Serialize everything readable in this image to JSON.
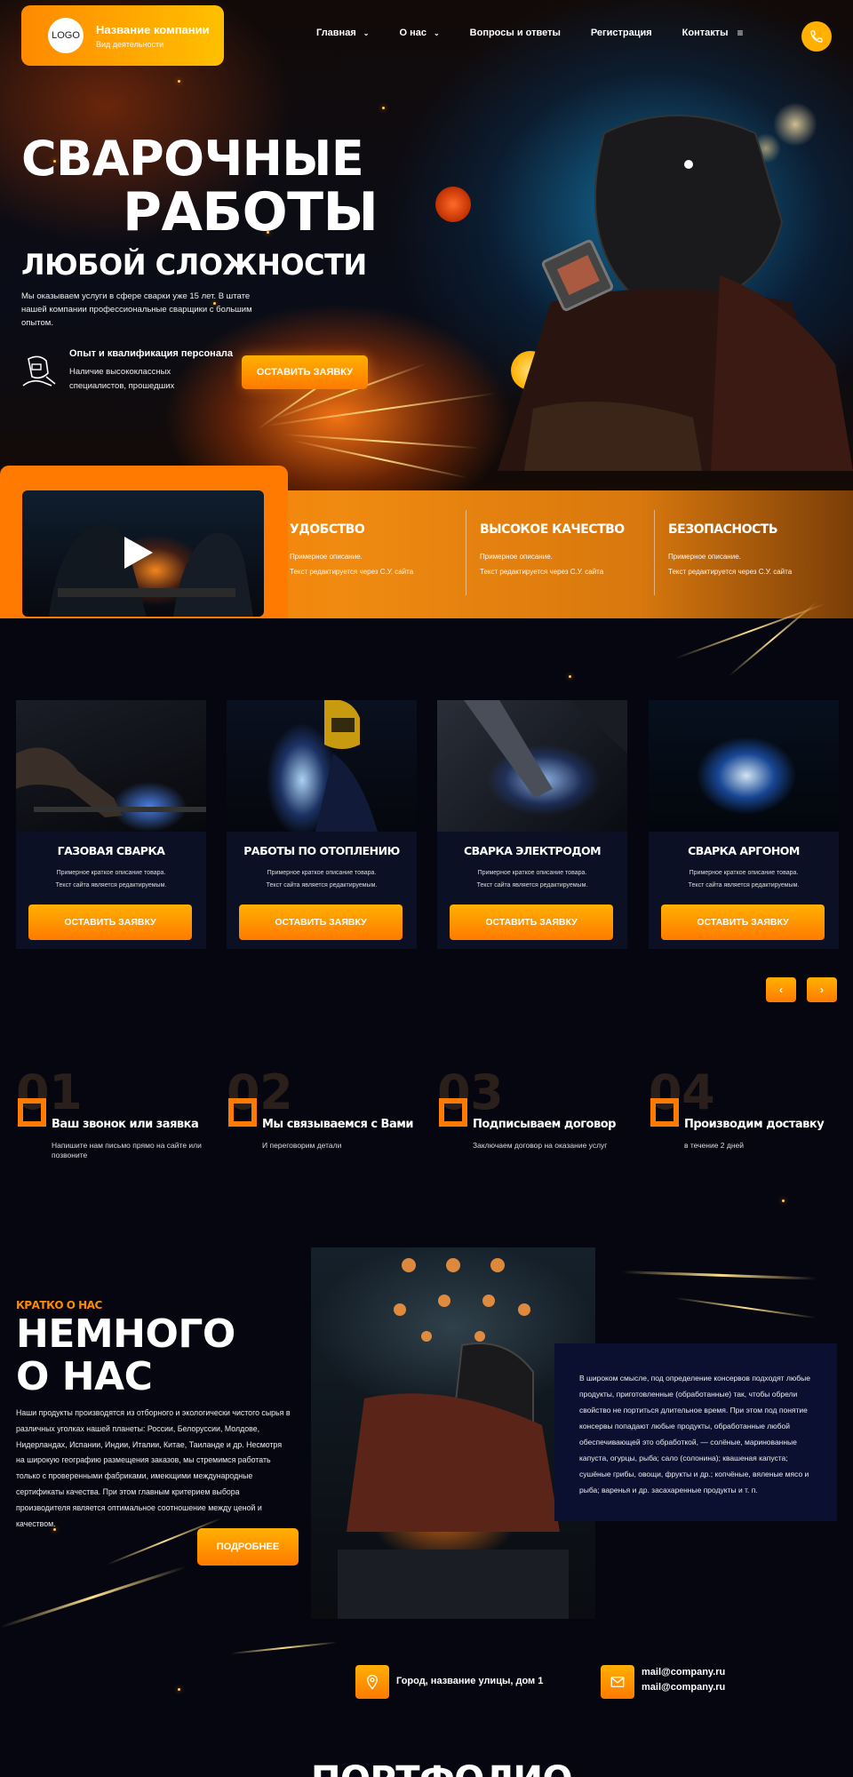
{
  "header": {
    "logo_text": "LOGO",
    "company_name": "Название компании",
    "company_activity": "Вид деятельности",
    "nav": [
      {
        "label": "Главная",
        "has_dropdown": true
      },
      {
        "label": "О нас",
        "has_dropdown": true
      },
      {
        "label": "Вопросы и ответы",
        "has_dropdown": false
      },
      {
        "label": "Регистрация",
        "has_dropdown": false
      },
      {
        "label": "Контакты",
        "has_dropdown": false
      }
    ],
    "nav_more_icon": "hamburger-icon",
    "phone_icon": "phone-icon",
    "chevron_glyph": "⌄",
    "hamburger_glyph": "≡"
  },
  "hero": {
    "title_line1": "СВАРОЧНЫЕ",
    "title_line2": "РАБОТЫ",
    "title_line3": "ЛЮБОЙ СЛОЖНОСТИ",
    "description": "Мы оказываем услуги в сфере сварки уже 15 лет. В штате нашей компании профессиональные сварщики с большим опытом.",
    "feature_title": "Опыт и квалификация персонала",
    "feature_text": "Наличие высококлассных специалистов, прошедших",
    "cta_label": "ОСТАВИТЬ ЗАЯВКУ"
  },
  "advantages": [
    {
      "title": "УДОБСТВО",
      "text1": "Примерное описание.",
      "text2": "Текст редактируется через С.У. сайта"
    },
    {
      "title": "ВЫСОКОЕ КАЧЕСТВО",
      "text1": "Примерное описание.",
      "text2": "Текст редактируется через С.У. сайта"
    },
    {
      "title": "БЕЗОПАСНОСТЬ",
      "text1": "Примерное описание.",
      "text2": "Текст редактируется через С.У. сайта"
    }
  ],
  "services": [
    {
      "title": "ГАЗОВАЯ СВАРКА",
      "text1": "Примерное краткое описание товара.",
      "text2": "Текст сайта является редактируемым.",
      "button": "ОСТАВИТЬ ЗАЯВКУ"
    },
    {
      "title": "РАБОТЫ ПО ОТОПЛЕНИЮ",
      "text1": "Примерное краткое описание товара.",
      "text2": "Текст сайта является редактируемым.",
      "button": "ОСТАВИТЬ ЗАЯВКУ"
    },
    {
      "title": "СВАРКА ЭЛЕКТРОДОМ",
      "text1": "Примерное краткое описание товара.",
      "text2": "Текст сайта является редактируемым.",
      "button": "ОСТАВИТЬ ЗАЯВКУ"
    },
    {
      "title": "СВАРКА АРГОНОМ",
      "text1": "Примерное краткое описание товара.",
      "text2": "Текст сайта является редактируемым.",
      "button": "ОСТАВИТЬ ЗАЯВКУ"
    }
  ],
  "slider": {
    "prev": "‹",
    "next": "›"
  },
  "steps": [
    {
      "num": "01",
      "title": "Ваш звонок или заявка",
      "text": "Напишите нам письмо прямо на сайте или позвоните"
    },
    {
      "num": "02",
      "title": "Мы связываемся с Вами",
      "text": "И переговорим детали"
    },
    {
      "num": "03",
      "title": "Подписываем договор",
      "text": "Заключаем договор на оказание услуг"
    },
    {
      "num": "04",
      "title": "Производим доставку",
      "text": "в течение 2 дней"
    }
  ],
  "about": {
    "label": "КРАТКО О НАС",
    "title_line1": "НЕМНОГО",
    "title_line2": "О НАС",
    "text": "Наши продукты производятся из отборного и экологически чистого сырья в различных уголках нашей планеты: России, Белоруссии, Молдове, Нидерландах, Испании, Индии, Италии, Китае, Таиланде и др. Несмотря на широкую географию размещения заказов, мы стремимся работать только с проверенными фабриками, имеющими международные сертификаты качества. При этом главным критерием выбора производителя является оптимальное соотношение между ценой и качеством.",
    "button": "ПОДРОБНЕЕ",
    "card_text": "В широком смысле, под определение консервов подходят любые продукты, приготовленные (обработанные) так, чтобы обрели свойство не портиться длительное время. При этом под понятие консервы попадают любые продукты, обработанные любой обеспечивающей это обработкой, — солёные, маринованные капуста, огурцы, рыба; сало (солонина); квашеная капуста; сушёные грибы, овощи, фрукты и др.; копчёные, вяленые мясо и рыба; варенья и др. засахаренные продукты и т. п."
  },
  "contacts": {
    "address": "Город, название улицы, дом 1",
    "email1": "mail@company.ru",
    "email2": "mail@company.ru",
    "address_icon": "location-icon",
    "email_icon": "envelope-icon"
  },
  "portfolio": {
    "title": "ПОРТФОЛИО"
  },
  "colors": {
    "accent": "#ff8a00",
    "accent_light": "#ffc000",
    "background": "#05060f",
    "card": "#0c1024"
  }
}
